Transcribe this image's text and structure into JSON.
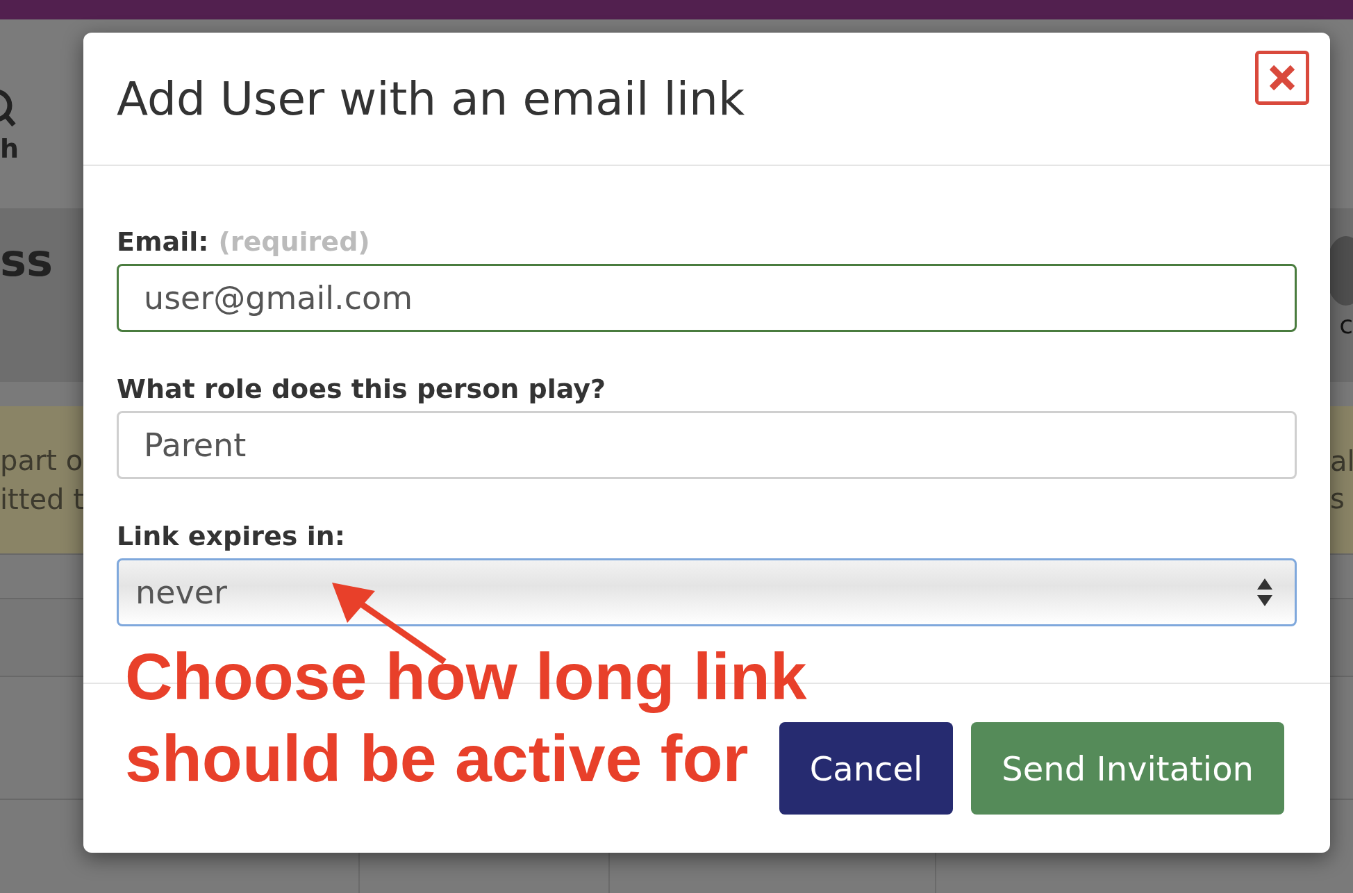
{
  "background": {
    "nav_fragment": "h",
    "header_fragment": "ss",
    "account_fragment": "c",
    "notice_left": [
      "part o",
      "itted t"
    ],
    "notice_right": [
      "al",
      "s"
    ]
  },
  "dialog": {
    "title": "Add User with an email link",
    "fields": [
      {
        "kind": "text",
        "label": "Email:",
        "hint": "(required)",
        "value": "user@gmail.com",
        "valid": true,
        "focused": false
      },
      {
        "kind": "text",
        "label": "What role does this person play?",
        "value": "Parent",
        "valid": false,
        "focused": false
      },
      {
        "kind": "select",
        "label": "Link expires in:",
        "value": "never",
        "valid": false,
        "focused": true
      }
    ],
    "buttons": [
      {
        "kind": "secondary",
        "label": "Cancel"
      },
      {
        "kind": "primary",
        "label": "Send Invitation"
      }
    ]
  },
  "annotation": {
    "lines": [
      "Choose how long link",
      "should be active for"
    ]
  }
}
